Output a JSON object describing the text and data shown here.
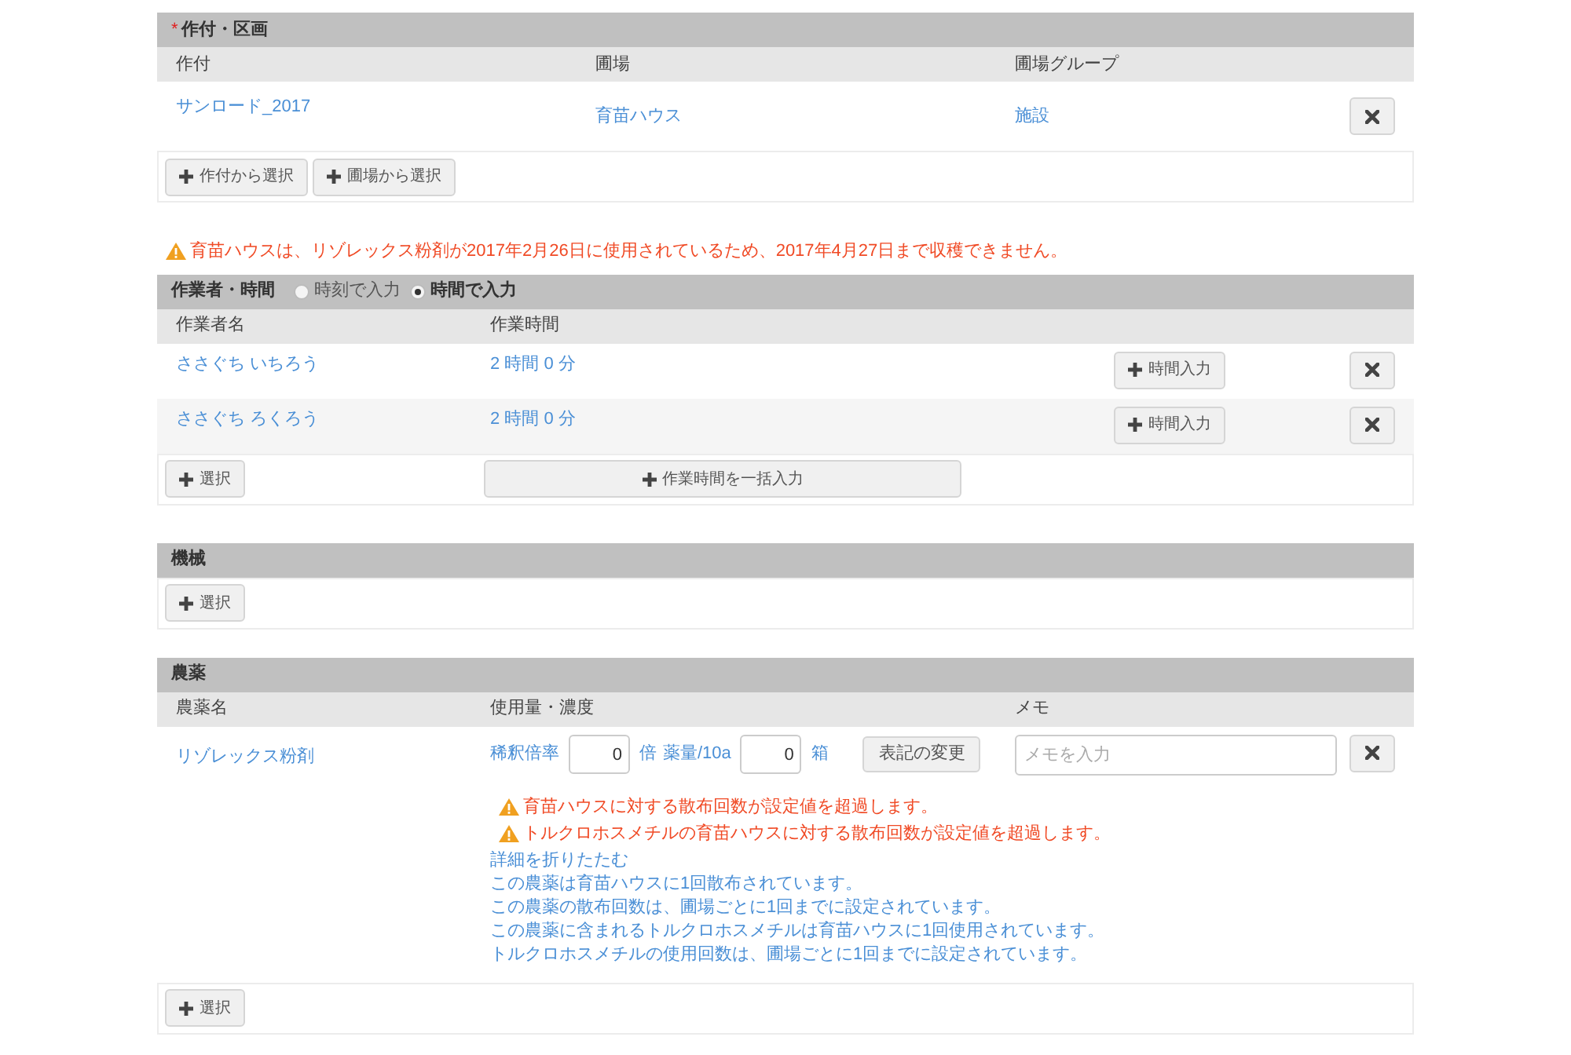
{
  "crop_section": {
    "title": "作付・区画",
    "required_mark": "*",
    "columns": [
      "作付",
      "圃場",
      "圃場グループ"
    ],
    "rows": [
      {
        "crop": "サンロード_2017",
        "field": "育苗ハウス",
        "group": "施設"
      }
    ],
    "buttons": [
      "作付から選択",
      "圃場から選択"
    ]
  },
  "harvest_warning": "育苗ハウスは、リゾレックス粉剤が2017年2月26日に使用されているため、2017年4月27日まで収穫できません。",
  "worker_section": {
    "title": "作業者・時間",
    "input_modes": [
      {
        "label": "時刻で入力",
        "selected": false
      },
      {
        "label": "時間で入力",
        "selected": true
      }
    ],
    "columns": [
      "作業者名",
      "作業時間"
    ],
    "rows": [
      {
        "name": "ささぐち いちろう",
        "duration": "2 時間 0 分",
        "button": "時間入力"
      },
      {
        "name": "ささぐち ろくろう",
        "duration": "2 時間 0 分",
        "button": "時間入力"
      }
    ],
    "buttons": [
      "選択",
      "作業時間を一括入力"
    ]
  },
  "machinery_section": {
    "title": "機械",
    "buttons": [
      "選択"
    ]
  },
  "pesticide_section": {
    "title": "農薬",
    "columns": [
      "農薬名",
      "使用量・濃度",
      "メモ"
    ],
    "rows": [
      {
        "name": "リゾレックス粉剤",
        "dilution_label": "稀釈倍率",
        "dilution_value": "0",
        "dilution_unit": "倍",
        "amount_label": "薬量/10a",
        "amount_value": "0",
        "amount_unit": "箱",
        "notation_button": "表記の変更",
        "memo_placeholder": "メモを入力",
        "warnings": [
          "育苗ハウスに対する散布回数が設定値を超過します。",
          "トルクロホスメチルの育苗ハウスに対する散布回数が設定値を超過します。"
        ],
        "details_toggle": "詳細を折りたたむ",
        "details": [
          "この農薬は育苗ハウスに1回散布されています。",
          "この農薬の散布回数は、圃場ごとに1回までに設定されています。",
          "この農薬に含まれるトルクロホスメチルは育苗ハウスに1回使用されています。",
          "トルクロホスメチルの使用回数は、圃場ごとに1回までに設定されています。"
        ]
      }
    ],
    "buttons": [
      "選択"
    ]
  }
}
